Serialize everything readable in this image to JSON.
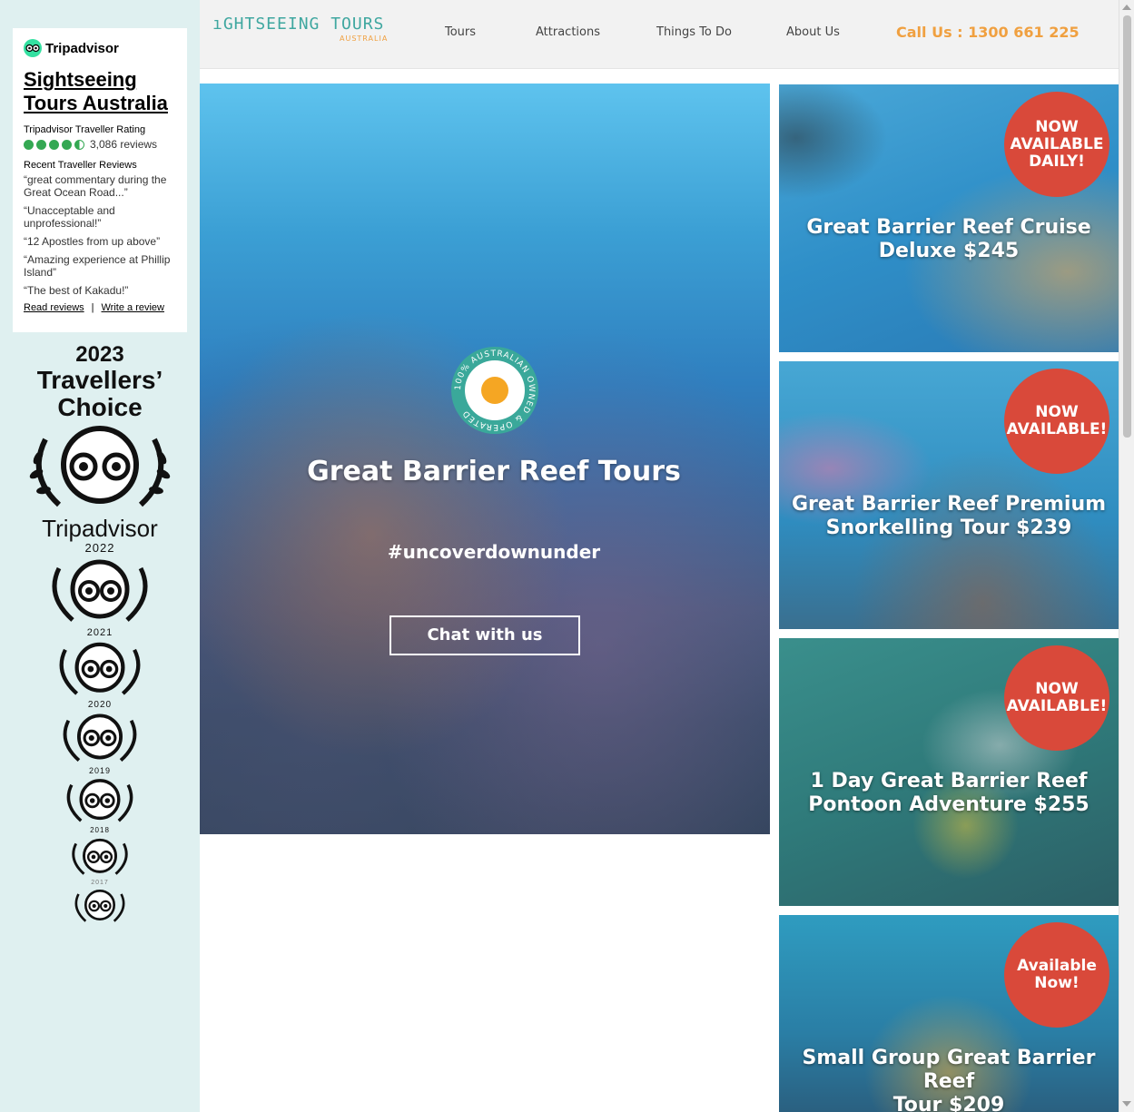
{
  "tripadvisor": {
    "brand": "Tripadvisor",
    "business_name": "Sightseeing Tours Australia",
    "rating_label": "Tripadvisor Traveller Rating",
    "rating_value": 4.5,
    "review_count": "3,086 reviews",
    "recent_label": "Recent Traveller Reviews",
    "reviews": [
      "“great commentary during the Great Ocean Road...”",
      "“Unacceptable and unprofessional!”",
      "“12 Apostles from up above”",
      "“Amazing experience at Phillip Island”",
      "“The best of Kakadu!”"
    ],
    "read_reviews": "Read reviews",
    "write_review": "Write a review"
  },
  "awards": {
    "top_year": "2023",
    "top_title_line1": "Travellers’",
    "top_title_line2": "Choice",
    "brand": "Tripadvisor",
    "years": [
      "2022",
      "2021",
      "2020",
      "2019",
      "2018",
      "2017"
    ]
  },
  "header": {
    "logo_text": "ıGHTSEEING TOURS",
    "logo_sub": "AUSTRALIA",
    "nav": [
      "Tours",
      "Attractions",
      "Things To Do",
      "About Us"
    ],
    "call": "Call Us : 1300 661 225"
  },
  "hero": {
    "badge_text": "100% AUSTRALIAN OWNED & OPERATED",
    "title": "Great Barrier Reef Tours",
    "tagline": "#uncoverdownunder",
    "cta": "Chat with us"
  },
  "cards": [
    {
      "title_line1": "Great Barrier Reef Cruise",
      "title_line2": "Deluxe $245",
      "badge_lines": [
        "NOW",
        "AVAILABLE",
        "DAILY!"
      ]
    },
    {
      "title_line1": "Great Barrier Reef Premium",
      "title_line2": "Snorkelling Tour $239",
      "badge_lines": [
        "NOW",
        "AVAILABLE!"
      ]
    },
    {
      "title_line1": "1 Day Great Barrier Reef",
      "title_line2": "Pontoon Adventure $255",
      "badge_lines": [
        "NOW",
        "AVAILABLE!"
      ]
    },
    {
      "title_line1": "Small Group Great Barrier Reef",
      "title_line2": "Tour $209",
      "badge_lines": [
        "Available",
        "Now!"
      ]
    }
  ],
  "colors": {
    "accent_orange": "#f0a040",
    "badge_red": "#d9493a",
    "teal": "#3fa7a0",
    "sidebar_bg": "#dff0f0",
    "ta_green": "#34a853"
  }
}
